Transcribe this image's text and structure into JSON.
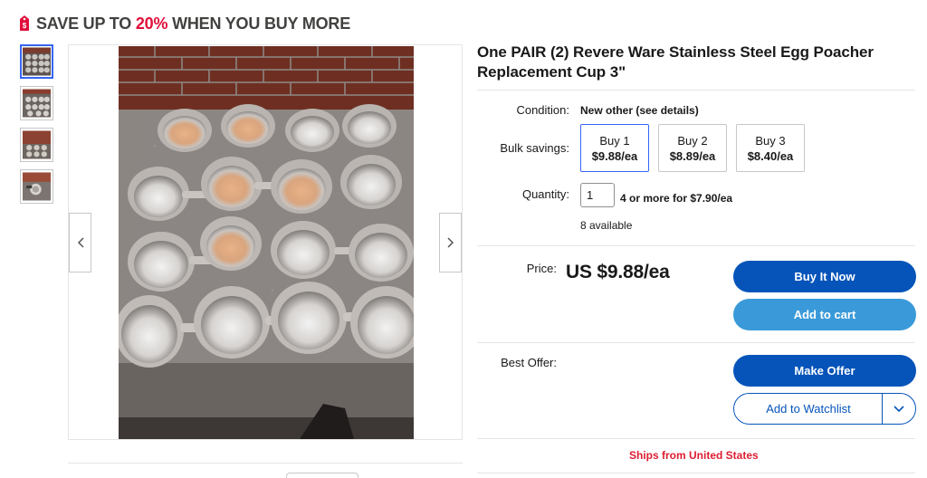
{
  "banner": {
    "prefix": "SAVE UP TO ",
    "percent": "20%",
    "suffix": " WHEN YOU BUY MORE",
    "icon": "price-tag-icon",
    "accent_color": "#e0103a"
  },
  "gallery": {
    "thumbnail_count": 4,
    "active_index": 0,
    "prev_icon": "chevron-left-icon",
    "next_icon": "chevron-right-icon"
  },
  "listing": {
    "title": "One PAIR (2) Revere Ware Stainless Steel Egg Poacher Replacement Cup 3\"",
    "condition_label": "Condition:",
    "condition_value": "New other (see details)",
    "bulk_label": "Bulk savings:",
    "bulk_options": [
      {
        "qty": "Buy 1",
        "price": "$9.88/ea",
        "selected": true
      },
      {
        "qty": "Buy 2",
        "price": "$8.89/ea",
        "selected": false
      },
      {
        "qty": "Buy 3",
        "price": "$8.40/ea",
        "selected": false
      }
    ],
    "quantity_label": "Quantity:",
    "quantity_value": "1",
    "quantity_deal": "4 or more for $7.90/ea",
    "available": "8 available",
    "price_label": "Price:",
    "price_value": "US $9.88/ea",
    "buy_now": "Buy It Now",
    "add_to_cart": "Add to cart",
    "best_offer_label": "Best Offer:",
    "make_offer": "Make Offer",
    "watchlist": "Add to Watchlist",
    "watchlist_icon": "chevron-down-icon",
    "ships_from": "Ships from United States",
    "colors": {
      "primary": "#0654ba",
      "secondary": "#3a9ad9",
      "selected_border": "#3665f3",
      "ships_red": "#dd1e31"
    }
  }
}
